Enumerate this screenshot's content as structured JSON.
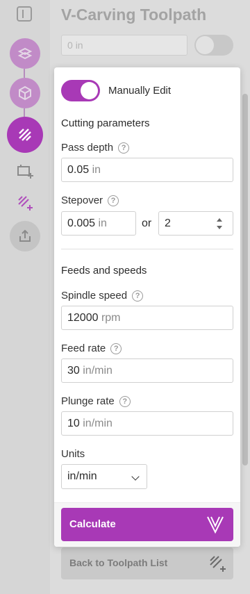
{
  "page": {
    "title": "V-Carving Toolpath"
  },
  "background": {
    "field_value": "0",
    "field_unit": "in",
    "back_label": "Back to Toolpath List"
  },
  "rail": {
    "icons": [
      "sidebar-toggle-icon",
      "shape-step-icon",
      "material-box-icon",
      "toolpath-step-icon",
      "add-tool-icon",
      "add-toolpath-icon",
      "export-icon"
    ]
  },
  "panel": {
    "manual_edit_label": "Manually Edit",
    "manual_edit_on": true,
    "cutting": {
      "heading": "Cutting parameters",
      "pass_depth": {
        "label": "Pass depth",
        "value": "0.05",
        "unit": "in"
      },
      "stepover": {
        "label": "Stepover",
        "value": "0.005",
        "unit": "in",
        "or": "or",
        "count": "2"
      }
    },
    "feeds": {
      "heading": "Feeds and speeds",
      "spindle_speed": {
        "label": "Spindle speed",
        "value": "12000",
        "unit": "rpm"
      },
      "feed_rate": {
        "label": "Feed rate",
        "value": "30",
        "unit": "in/min"
      },
      "plunge_rate": {
        "label": "Plunge rate",
        "value": "10",
        "unit": "in/min"
      },
      "units": {
        "label": "Units",
        "selected": "in/min"
      }
    },
    "calculate_label": "Calculate",
    "help_glyph": "?"
  },
  "colors": {
    "accent": "#a839b6",
    "accent_dim": "#b04fbc"
  }
}
